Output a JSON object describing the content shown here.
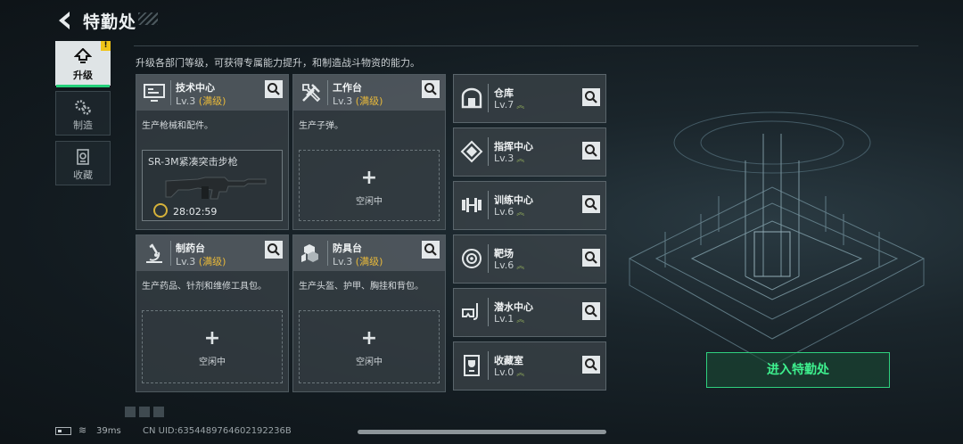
{
  "header": {
    "title": "特勤处"
  },
  "nav": [
    {
      "label": "升级",
      "icon": "upgrade-icon",
      "active": true,
      "badge": "!"
    },
    {
      "label": "制造",
      "icon": "gears-icon",
      "active": false
    },
    {
      "label": "收藏",
      "icon": "collection-icon",
      "active": false
    }
  ],
  "description": "升级各部门等级，可获得专属能力提升，和制造战斗物资的能力。",
  "facilities": [
    {
      "name": "技术中心",
      "level": "Lv.3",
      "max": "(满级)",
      "icon": "monitor-icon",
      "desc": "生产枪械和配件。",
      "craft": {
        "item": "SR-3M紧凑突击步枪",
        "timer": "28:02:59"
      }
    },
    {
      "name": "工作台",
      "level": "Lv.3",
      "max": "(满级)",
      "icon": "tools-icon",
      "desc": "生产子弹。",
      "slot": {
        "plus": "+",
        "status": "空闲中"
      }
    },
    {
      "name": "制药台",
      "level": "Lv.3",
      "max": "(满级)",
      "icon": "microscope-icon",
      "desc": "生产药品、针剂和维修工具包。",
      "slot": {
        "plus": "+",
        "status": "空闲中"
      }
    },
    {
      "name": "防具台",
      "level": "Lv.3",
      "max": "(满级)",
      "icon": "armor-icon",
      "desc": "生产头盔、护甲、胸挂和背包。",
      "slot": {
        "plus": "+",
        "status": "空闲中"
      }
    }
  ],
  "departments": [
    {
      "name": "仓库",
      "level": "Lv.7",
      "icon": "warehouse-icon"
    },
    {
      "name": "指挥中心",
      "level": "Lv.3",
      "icon": "command-icon"
    },
    {
      "name": "训练中心",
      "level": "Lv.6",
      "icon": "dumbbell-icon"
    },
    {
      "name": "靶场",
      "level": "Lv.6",
      "icon": "target-icon"
    },
    {
      "name": "潜水中心",
      "level": "Lv.1",
      "icon": "diving-mask-icon"
    },
    {
      "name": "收藏室",
      "level": "Lv.0",
      "icon": "trophy-icon"
    }
  ],
  "up_arrows": "︽",
  "enter_button": "进入特勤处",
  "status_bar": {
    "ping": "39ms",
    "uid": "CN UID:6354489764602192236B"
  },
  "colors": {
    "accent": "#2fd07e",
    "max_level": "#e8b93a",
    "badge": "#f0c419"
  }
}
